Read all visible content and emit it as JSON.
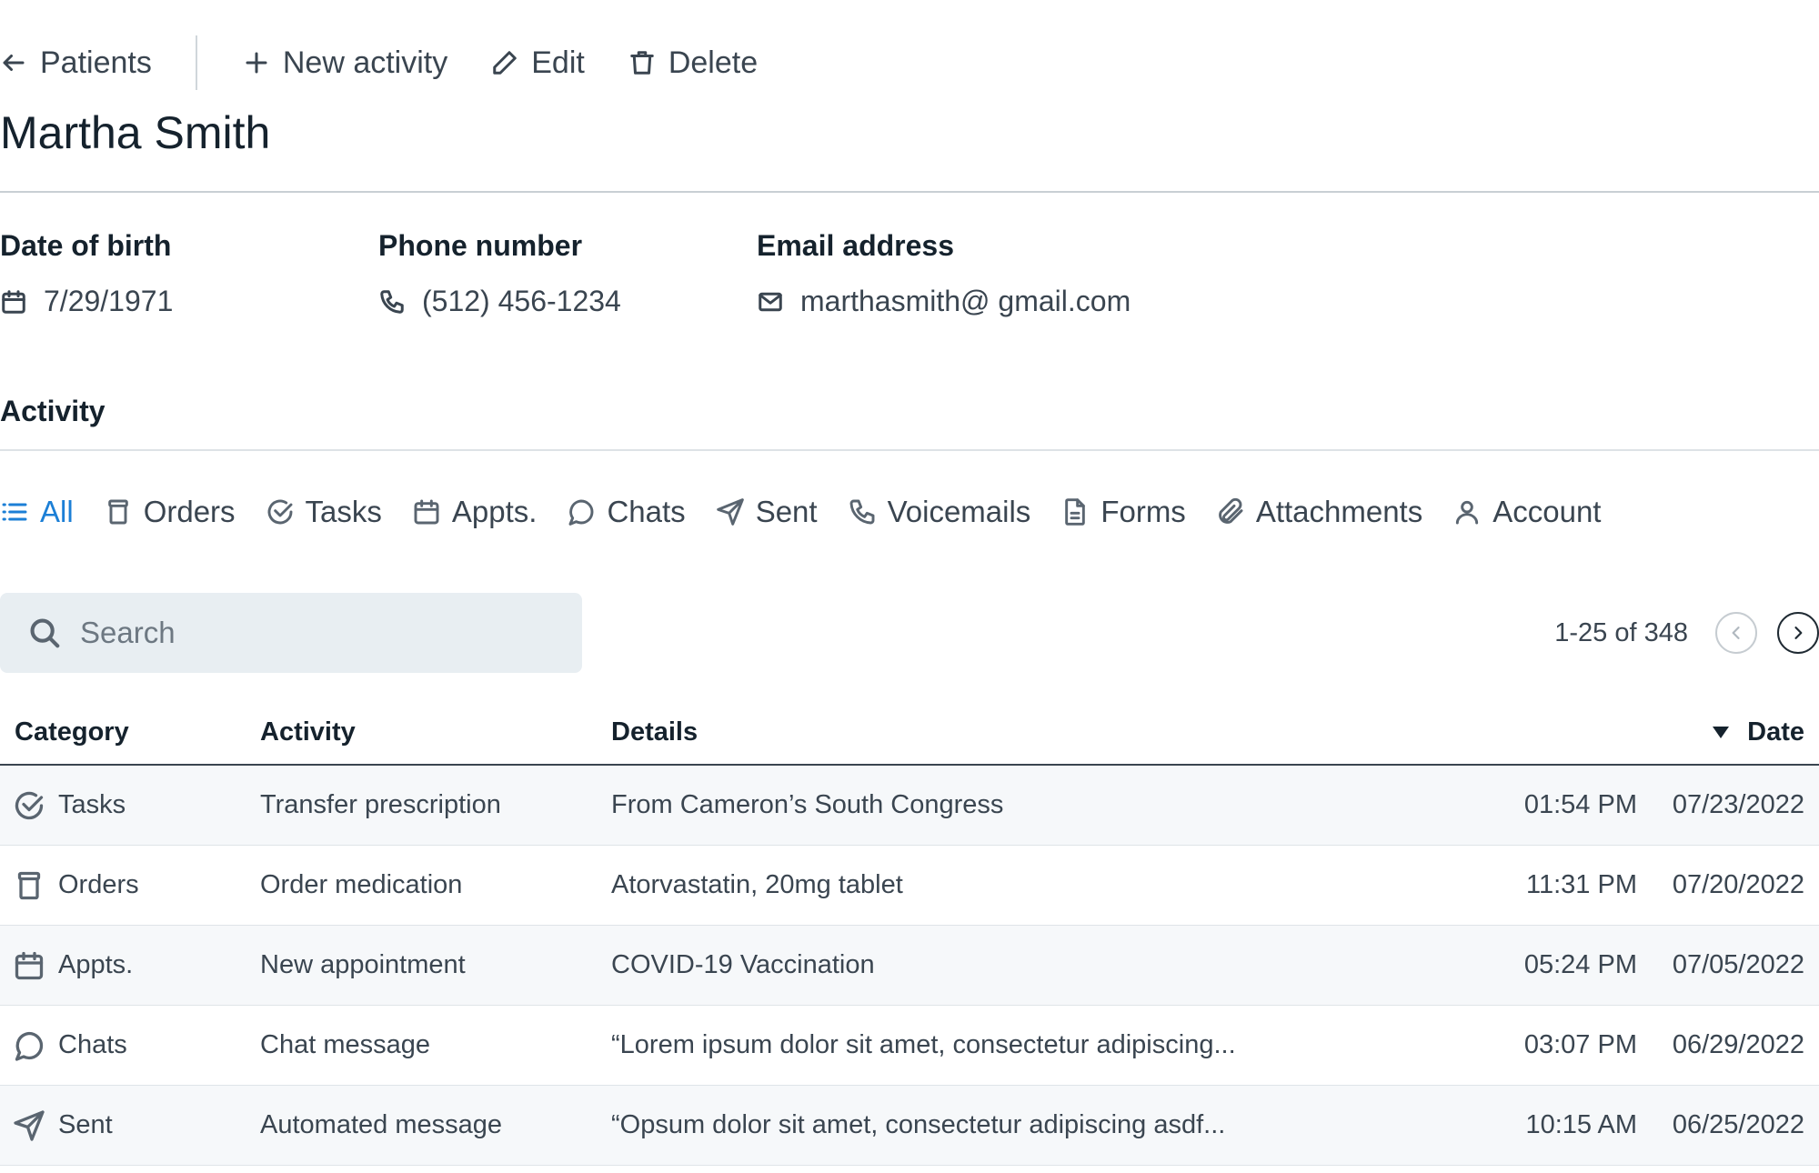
{
  "toolbar": {
    "back_label": "Patients",
    "new_activity_label": "New activity",
    "edit_label": "Edit",
    "delete_label": "Delete"
  },
  "patient": {
    "name": "Martha Smith",
    "dob_label": "Date of birth",
    "dob": "7/29/1971",
    "phone_label": "Phone number",
    "phone": "(512) 456-1234",
    "email_label": "Email address",
    "email": "marthasmith@ gmail.com"
  },
  "activity": {
    "title": "Activity",
    "filters": [
      {
        "label": "All",
        "icon": "list-icon",
        "active": true
      },
      {
        "label": "Orders",
        "icon": "pill-bottle-icon"
      },
      {
        "label": "Tasks",
        "icon": "check-circle-icon"
      },
      {
        "label": "Appts.",
        "icon": "calendar-icon"
      },
      {
        "label": "Chats",
        "icon": "chat-bubble-icon"
      },
      {
        "label": "Sent",
        "icon": "send-icon"
      },
      {
        "label": "Voicemails",
        "icon": "phone-icon"
      },
      {
        "label": "Forms",
        "icon": "document-icon"
      },
      {
        "label": "Attachments",
        "icon": "paperclip-icon"
      },
      {
        "label": "Account",
        "icon": "user-icon"
      }
    ],
    "accent_color": "#1c7fd6"
  },
  "search": {
    "placeholder": "Search",
    "value": ""
  },
  "pagination": {
    "text": "1-25 of 348"
  },
  "table": {
    "columns": {
      "category": "Category",
      "activity": "Activity",
      "details": "Details",
      "date": "Date"
    },
    "sort": "date-descending",
    "rows": [
      {
        "category": "Tasks",
        "icon": "check-circle-icon",
        "activity": "Transfer prescription",
        "details": "From Cameron’s South Congress",
        "time": "01:54 PM",
        "date": "07/23/2022"
      },
      {
        "category": "Orders",
        "icon": "pill-bottle-icon",
        "activity": "Order medication",
        "details": "Atorvastatin, 20mg tablet",
        "time": "11:31 PM",
        "date": "07/20/2022"
      },
      {
        "category": "Appts.",
        "icon": "calendar-icon",
        "activity": "New appointment",
        "details": "COVID-19 Vaccination",
        "time": "05:24 PM",
        "date": "07/05/2022"
      },
      {
        "category": "Chats",
        "icon": "chat-bubble-icon",
        "activity": "Chat message",
        "details": "“Lorem ipsum dolor sit amet, consectetur adipiscing...",
        "time": "03:07 PM",
        "date": "06/29/2022"
      },
      {
        "category": "Sent",
        "icon": "send-icon",
        "activity": "Automated message",
        "details": "“Opsum dolor sit amet, consectetur adipiscing asdf...",
        "time": "10:15 AM",
        "date": "06/25/2022"
      }
    ]
  }
}
